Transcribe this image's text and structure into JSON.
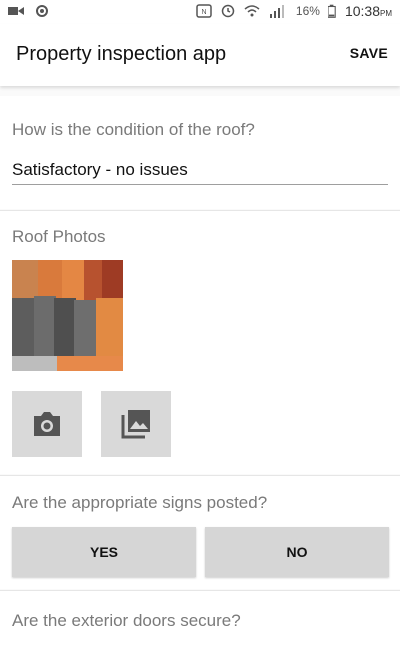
{
  "status_bar": {
    "battery": "16%",
    "time": "10:38",
    "ampm": "PM",
    "icons": [
      "video-icon",
      "notification-icon",
      "nfc-icon",
      "alarm-icon",
      "wifi-icon",
      "lte-signal-icon",
      "battery-icon"
    ]
  },
  "app_bar": {
    "title": "Property inspection app",
    "save_label": "SAVE"
  },
  "questions": {
    "roof_condition": {
      "label": "How is the condition of the roof?",
      "value": "Satisfactory - no issues"
    },
    "roof_photos": {
      "label": "Roof Photos",
      "actions": [
        "camera-icon",
        "gallery-icon"
      ]
    },
    "signs_posted": {
      "label": "Are the appropriate signs posted?",
      "options": [
        "YES",
        "NO"
      ]
    },
    "exterior_doors": {
      "label": "Are the exterior doors secure?"
    }
  },
  "colors": {
    "button_bg": "#d9d9d9",
    "label_grey": "#7a7a7a"
  }
}
